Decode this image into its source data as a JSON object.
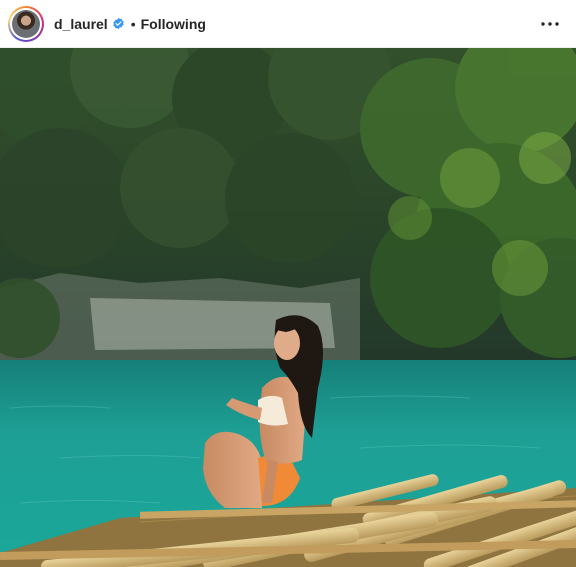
{
  "header": {
    "username": "d_laurel",
    "separator": "•",
    "follow_state": "Following"
  },
  "icons": {
    "verified": "verified-badge-icon",
    "more": "more-options-icon",
    "avatar": "profile-avatar"
  },
  "colors": {
    "verified_blue": "#3897f0",
    "text": "#262626",
    "water": "#1ea39a",
    "forest": "#2c4a2a"
  },
  "photo": {
    "description_tag": "post-photo"
  }
}
